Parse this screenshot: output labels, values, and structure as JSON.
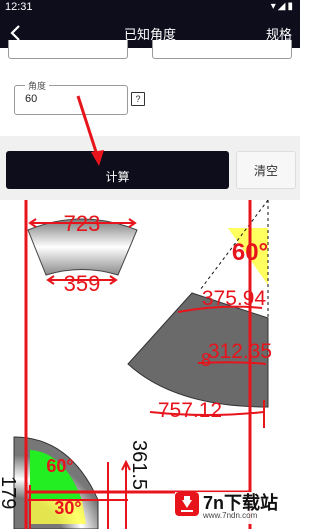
{
  "status_bar": {
    "time": "12:31",
    "icons": [
      "wifi-icon",
      "signal-icon",
      "battery-icon"
    ]
  },
  "app_bar": {
    "title": "已知角度",
    "right_action": "规格"
  },
  "form": {
    "angle_label": "角度",
    "angle_value": "60",
    "help_glyph": "?"
  },
  "actions": {
    "calculate": "计算",
    "clear": "清空"
  },
  "drawing": {
    "trapezoid": {
      "top_length": "723",
      "bottom_length": "359"
    },
    "sector": {
      "angle": "60°",
      "outer_arc": "375.94",
      "inner_arc": "312.35",
      "inner_offset": "8",
      "bottom_arc": "757.12"
    },
    "elbow": {
      "angle_upper": "60°",
      "angle_lower": "30°",
      "right_dim": "361.5",
      "left_dim": "179"
    },
    "colors": {
      "accent_red": "#e8141c",
      "fill_yellow": "#ffff44",
      "fill_green": "#22ee22",
      "dark": "#0d0d1c"
    }
  },
  "watermark": {
    "name": "7n下载站",
    "url": "www.7ndn.com"
  }
}
